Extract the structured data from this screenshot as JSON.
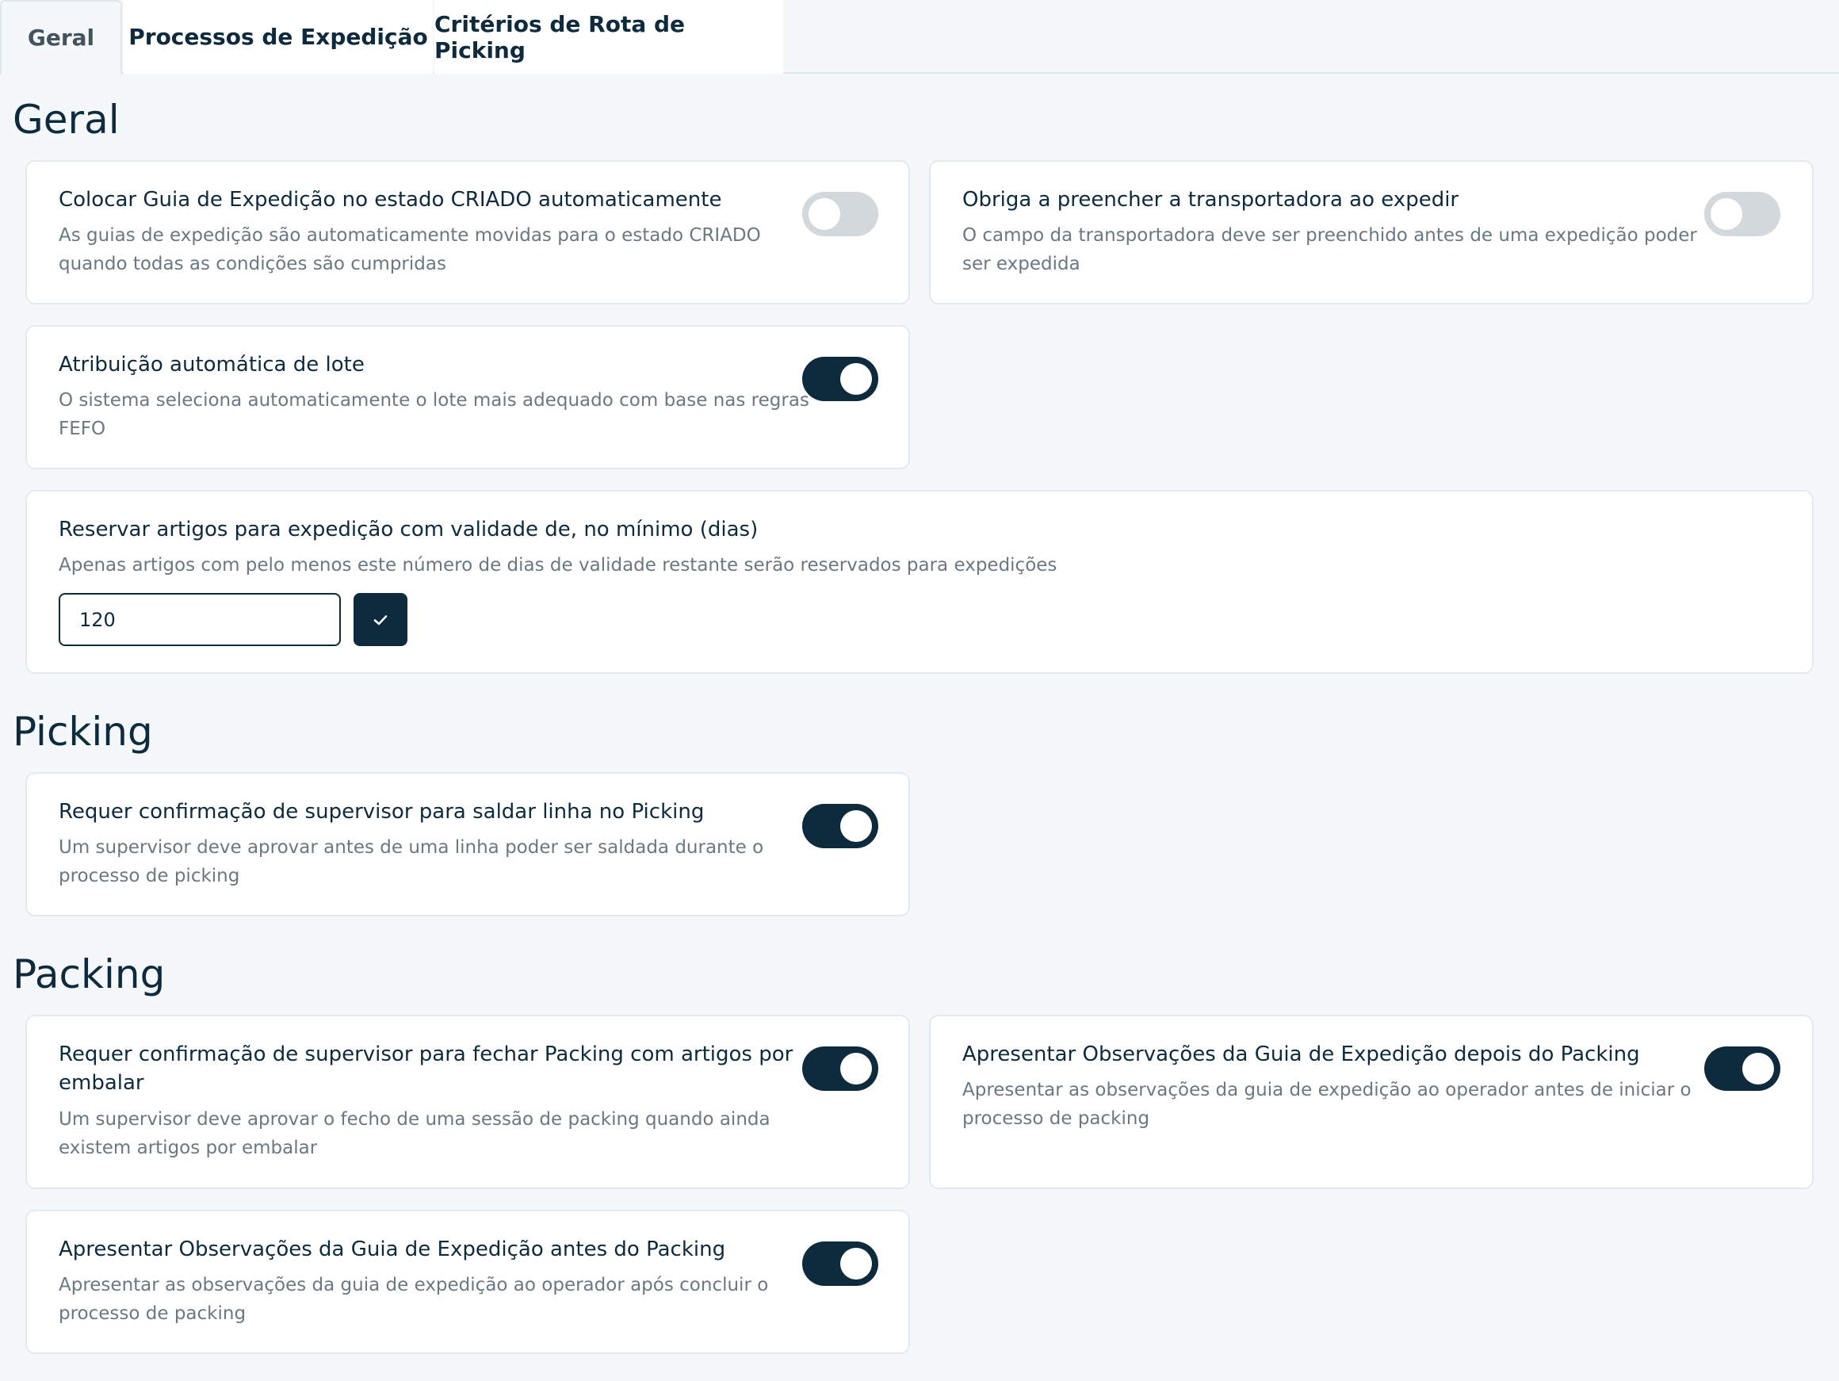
{
  "tabs": [
    {
      "label": "Geral",
      "active": true
    },
    {
      "label": "Processos de Expedição",
      "active": false
    },
    {
      "label": "Critérios de Rota de Picking",
      "active": false
    }
  ],
  "sections": {
    "geral": {
      "title": "Geral",
      "auto_created": {
        "title": "Colocar Guia de Expedição no estado CRIADO automaticamente",
        "desc_line1": "As guias de expedição são automaticamente movidas para o estado CRIADO",
        "desc_line2": "quando todas as condições são cumpridas",
        "enabled": false
      },
      "carrier_required": {
        "title": "Obriga a preencher a transportadora ao expedir",
        "desc_line1": "O campo da transportadora deve ser preenchido antes de uma expedição poder",
        "desc_line2": "ser expedida",
        "enabled": false
      },
      "auto_lot": {
        "title": "Atribuição automática de lote",
        "desc_line1": "O sistema seleciona automaticamente o lote mais adequado com base nas regras",
        "desc_line2": "FEFO",
        "enabled": true
      },
      "min_validity": {
        "title": "Reservar artigos para expedição com validade de, no mínimo (dias)",
        "desc": "Apenas artigos com pelo menos este número de dias de validade restante serão reservados para expedições",
        "value": "120",
        "confirm_icon": "check-icon"
      }
    },
    "picking": {
      "title": "Picking",
      "supervisor_settle": {
        "title": "Requer confirmação de supervisor para saldar linha no Picking",
        "desc_line1": "Um supervisor deve aprovar antes de uma linha poder ser saldada durante o",
        "desc_line2": "processo de picking",
        "enabled": true
      }
    },
    "packing": {
      "title": "Packing",
      "supervisor_close": {
        "title_line1": "Requer confirmação de supervisor para fechar Packing com artigos por",
        "title_line2": "embalar",
        "desc_line1": "Um supervisor deve aprovar o fecho de uma sessão de packing quando ainda",
        "desc_line2": "existem artigos por embalar",
        "enabled": true
      },
      "notes_after": {
        "title": "Apresentar Observações da Guia de Expedição depois do Packing",
        "desc_line1": "Apresentar as observações da guia de expedição ao operador antes de iniciar o",
        "desc_line2": "processo de packing",
        "enabled": true
      },
      "notes_before": {
        "title": "Apresentar Observações da Guia de Expedição antes do Packing",
        "desc_line1": "Apresentar as observações da guia de expedição ao operador após concluir o",
        "desc_line2": "processo de packing",
        "enabled": true
      }
    }
  },
  "colors": {
    "primary": "#0e2a3d",
    "toggle_off": "#d3d8dd",
    "background": "#f5f8fb",
    "muted_text": "#6a7883"
  }
}
